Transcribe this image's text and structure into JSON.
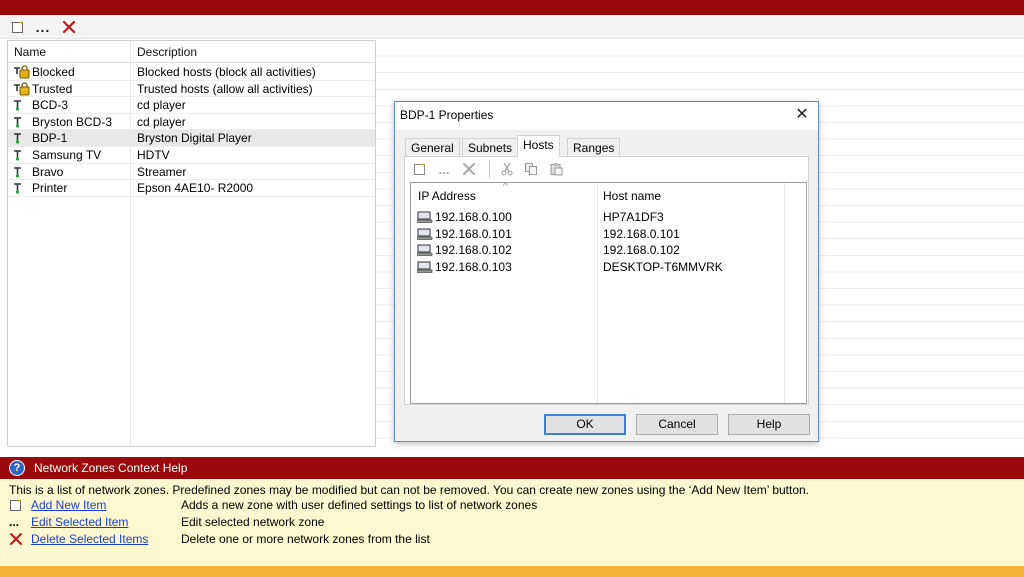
{
  "toolbar": {
    "add_icon": "new-item-icon",
    "edit_label": "...",
    "delete_icon": "delete-x-icon"
  },
  "list": {
    "columns": [
      "Name",
      "Description"
    ],
    "rows": [
      {
        "name": "Blocked",
        "description": "Blocked hosts (block all activities)",
        "icon": "locked-zone-icon"
      },
      {
        "name": "Trusted",
        "description": "Trusted hosts (allow all activities)",
        "icon": "locked-zone-icon"
      },
      {
        "name": "BCD-3",
        "description": "cd player",
        "icon": "network-zone-icon"
      },
      {
        "name": "Bryston BCD-3",
        "description": "cd player",
        "icon": "network-zone-icon"
      },
      {
        "name": "BDP-1",
        "description": "Bryston Digital Player",
        "icon": "network-zone-icon",
        "selected": true
      },
      {
        "name": "Samsung TV",
        "description": "HDTV",
        "icon": "network-zone-icon"
      },
      {
        "name": "Bravo",
        "description": "Streamer",
        "icon": "network-zone-icon"
      },
      {
        "name": "Printer",
        "description": "Epson 4AE10- R2000",
        "icon": "network-zone-icon"
      }
    ]
  },
  "dialog": {
    "title": "BDP-1 Properties",
    "close_label": "✕",
    "tabs": [
      "General",
      "Subnets",
      "Hosts",
      "Ranges"
    ],
    "active_tab": "Hosts",
    "columns": [
      "IP Address",
      "Host name"
    ],
    "hosts": [
      {
        "ip": "192.168.0.100",
        "host": "HP7A1DF3"
      },
      {
        "ip": "192.168.0.101",
        "host": "192.168.0.101"
      },
      {
        "ip": "192.168.0.102",
        "host": "192.168.0.102"
      },
      {
        "ip": "192.168.0.103",
        "host": "DESKTOP-T6MMVRK"
      }
    ],
    "buttons": {
      "ok": "OK",
      "cancel": "Cancel",
      "help": "Help"
    }
  },
  "help": {
    "title": "Network Zones Context Help",
    "question_mark": "?",
    "text": "This is a list of network zones. Predefined zones may be modified but can not be removed. You can create new zones using the ‘Add New Item’ button.",
    "items": [
      {
        "link": "Add New Item",
        "description": "Adds a new zone with user defined settings to list of network zones",
        "icon": "new-item-icon"
      },
      {
        "link": "Edit Selected Item",
        "description": "Edit selected network zone",
        "icon": "dots-icon",
        "glyph": "..."
      },
      {
        "link": "Delete Selected Items",
        "description": "Delete one or more network zones from the list",
        "icon": "delete-x-icon"
      }
    ]
  },
  "colors": {
    "brand_red": "#9b0a0a",
    "help_bg": "#fdf8d0",
    "link_blue": "#1a3fd0",
    "accent_orange": "#f5b238",
    "dialog_border": "#5b8fd6"
  }
}
